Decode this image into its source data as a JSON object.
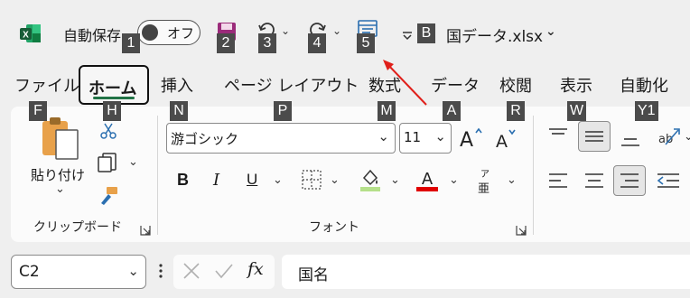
{
  "titlebar": {
    "autosave_label": "自動保存",
    "autosave_state": "オフ",
    "filename_letter": "B",
    "filename": "国データ.xlsx",
    "qat_keys": [
      "1",
      "2",
      "3",
      "4",
      "5"
    ]
  },
  "tabs": [
    {
      "label": "ファイル",
      "key": "F"
    },
    {
      "label": "ホーム",
      "key": "H",
      "selected": true
    },
    {
      "label": "挿入",
      "key": "N"
    },
    {
      "label": "ページ レイアウト",
      "key": "P"
    },
    {
      "label": "数式",
      "key": "M"
    },
    {
      "label": "データ",
      "key": "A"
    },
    {
      "label": "校閲",
      "key": "R"
    },
    {
      "label": "表示",
      "key": "W"
    },
    {
      "label": "自動化",
      "key": "Y1"
    }
  ],
  "clipboard": {
    "paste_label": "貼り付け",
    "group_label": "クリップボード"
  },
  "font": {
    "font_name": "游ゴシック",
    "font_size": "11",
    "group_label": "フォント",
    "bold": "B",
    "italic": "I",
    "underline": "U",
    "phonetic_top": "ア",
    "phonetic_bottom": "亜"
  },
  "formula_bar": {
    "name_box": "C2",
    "fx": "fx",
    "content": "国名"
  },
  "colors": {
    "accent_green": "#217346",
    "fill_color": "#b5e08a",
    "font_color": "#e00000",
    "arrow_red": "#e0201b",
    "qat_purple": "#9b2b7a"
  }
}
